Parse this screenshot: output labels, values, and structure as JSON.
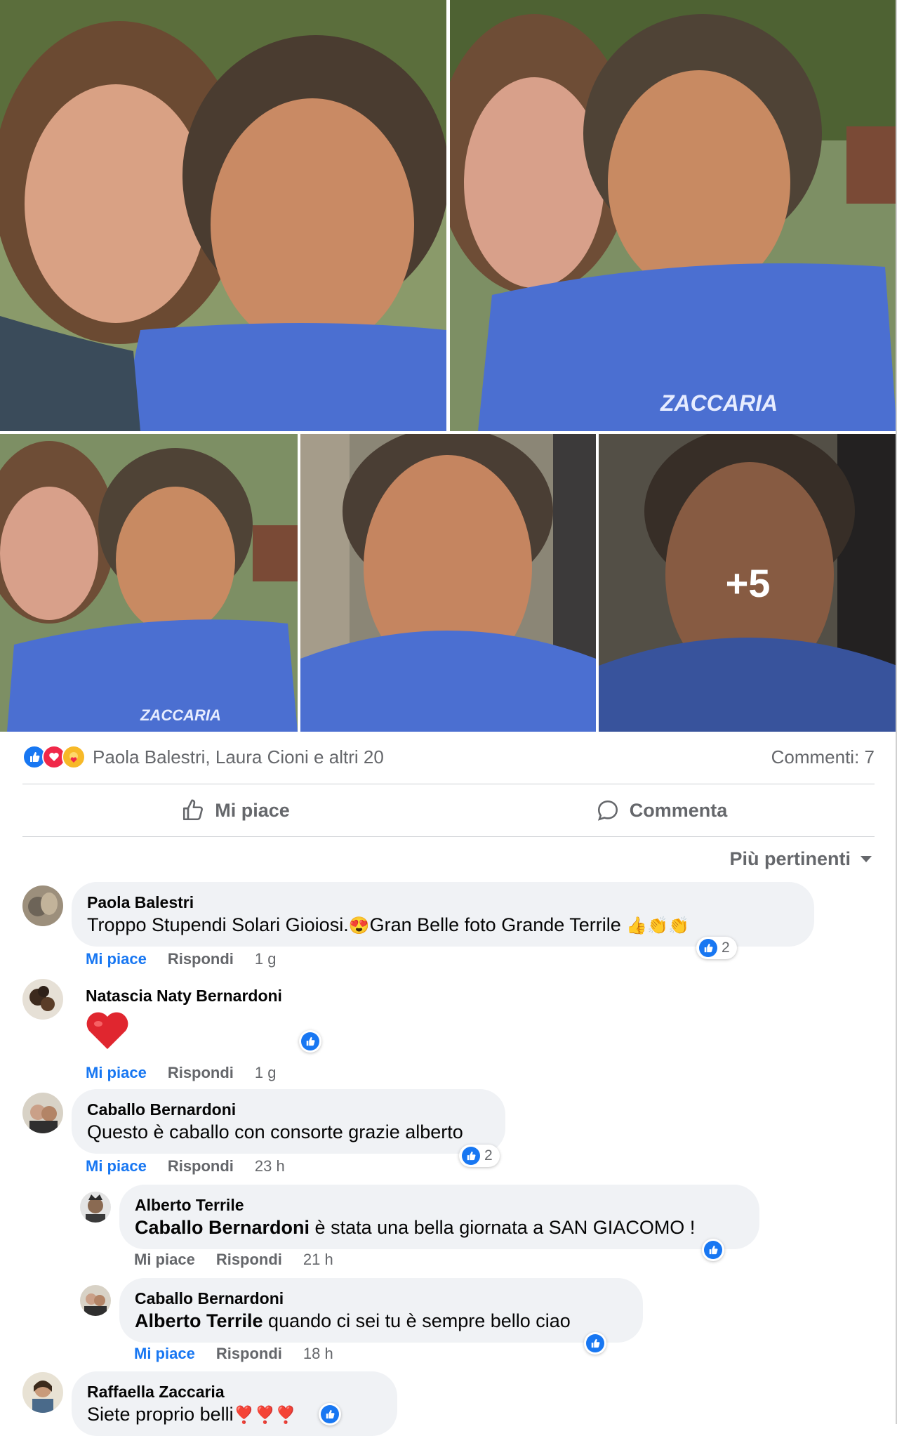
{
  "photos": {
    "overflow_count": "+5",
    "shirt_logo": "ZACCARIA"
  },
  "post_reactions": {
    "icons": [
      "like-icon",
      "love-icon",
      "care-icon"
    ],
    "names": "Paola Balestri, Laura Cioni e altri 20",
    "comments_count": "Commenti: 7"
  },
  "actions": {
    "like_label": "Mi piace",
    "comment_label": "Commenta"
  },
  "sort": {
    "label": "Più pertinenti"
  },
  "comments": [
    {
      "author": "Paola Balestri",
      "text": "Troppo Stupendi Solari Gioiosi.",
      "text_suffix": "Gran Belle foto Grande Terrile",
      "emojis_inline": "😍",
      "emojis_end": "👍👏👏",
      "like": "Mi piace",
      "reply": "Rispondi",
      "time": "1 g",
      "reaction_count": "2"
    },
    {
      "author": "Natascia Naty Bernardoni",
      "text": "❤️",
      "like": "Mi piace",
      "reply": "Rispondi",
      "time": "1 g"
    },
    {
      "author": "Caballo Bernardoni",
      "text": "Questo è caballo con consorte grazie alberto",
      "like": "Mi piace",
      "reply": "Rispondi",
      "time": "23 h",
      "reaction_count": "2"
    },
    {
      "author": "Alberto Terrile",
      "mention": "Caballo Bernardoni",
      "text": " è stata una bella giornata a SAN GIACOMO !",
      "like": "Mi piace",
      "reply": "Rispondi",
      "time": "21 h"
    },
    {
      "author": "Caballo Bernardoni",
      "mention": "Alberto Terrile",
      "text": " quando ci sei tu è sempre bello ciao",
      "like": "Mi piace",
      "reply": "Rispondi",
      "time": "18 h"
    },
    {
      "author": "Raffaella Zaccaria",
      "text": "Siete proprio belli",
      "emojis_end": "❣️❣️❣️"
    }
  ],
  "colors": {
    "brand_blue": "#1877f2",
    "bubble_bg": "#f0f2f5",
    "muted_text": "#65676b",
    "shirt_blue": "#4b6fd1"
  }
}
